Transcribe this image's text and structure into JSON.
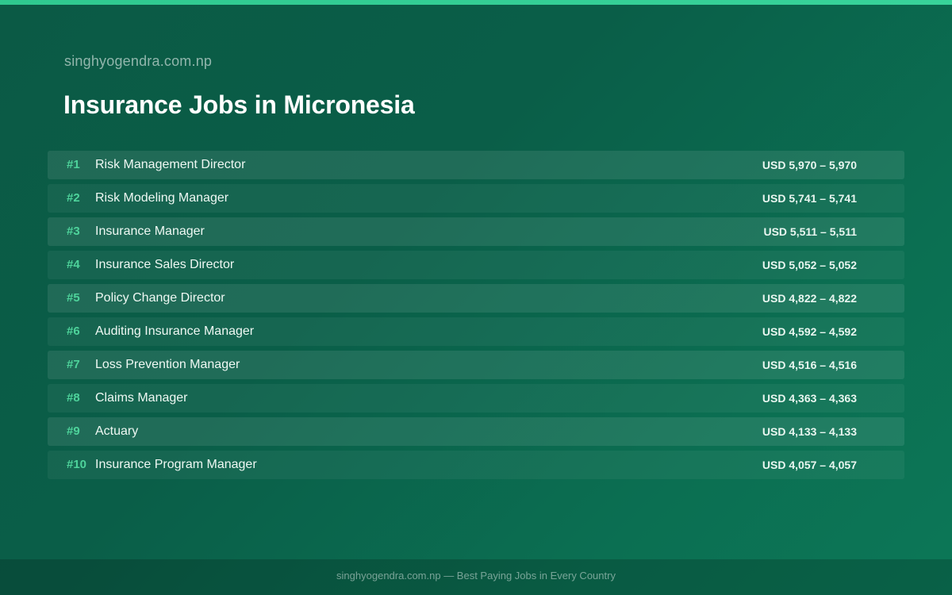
{
  "header": {
    "site": "singhyogendra.com.np",
    "title": "Insurance Jobs in Micronesia"
  },
  "jobs": [
    {
      "rank": "#1",
      "title": "Risk Management Director",
      "salary": "USD 5,970 – 5,970"
    },
    {
      "rank": "#2",
      "title": "Risk Modeling Manager",
      "salary": "USD 5,741 – 5,741"
    },
    {
      "rank": "#3",
      "title": "Insurance Manager",
      "salary": "USD 5,511 – 5,511"
    },
    {
      "rank": "#4",
      "title": "Insurance Sales Director",
      "salary": "USD 5,052 – 5,052"
    },
    {
      "rank": "#5",
      "title": "Policy Change Director",
      "salary": "USD 4,822 – 4,822"
    },
    {
      "rank": "#6",
      "title": "Auditing Insurance Manager",
      "salary": "USD 4,592 – 4,592"
    },
    {
      "rank": "#7",
      "title": "Loss Prevention Manager",
      "salary": "USD 4,516 – 4,516"
    },
    {
      "rank": "#8",
      "title": "Claims Manager",
      "salary": "USD 4,363 – 4,363"
    },
    {
      "rank": "#9",
      "title": "Actuary",
      "salary": "USD 4,133 – 4,133"
    },
    {
      "rank": "#10",
      "title": "Insurance Program Manager",
      "salary": "USD 4,057 – 4,057"
    }
  ],
  "footer": {
    "text": "singhyogendra.com.np — Best Paying Jobs in Every Country"
  },
  "colors": {
    "accent": "#4ed39b",
    "background": "#0b5e48",
    "topbar": "#2fc98f"
  }
}
